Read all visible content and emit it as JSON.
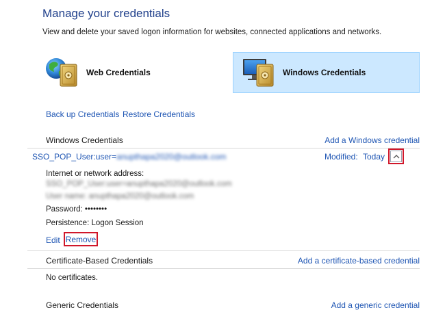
{
  "header": {
    "title": "Manage your credentials",
    "subtitle": "View and delete your saved logon information for websites, connected applications and networks."
  },
  "categories": {
    "web": {
      "label": "Web Credentials",
      "icon": "web-credentials-icon",
      "selected": false
    },
    "windows": {
      "label": "Windows Credentials",
      "icon": "windows-credentials-icon",
      "selected": true
    }
  },
  "actions": {
    "backup": "Back up Credentials",
    "restore": "Restore Credentials"
  },
  "windows_section": {
    "label": "Windows Credentials",
    "add_link": "Add a Windows credential",
    "entry": {
      "name_prefix": "SSO_POP_User:user=",
      "name_account": "anupthapa2020@outlook.com",
      "modified_label": "Modified:",
      "modified_value": "Today",
      "address_label": "Internet or network address:",
      "address_value": "SSO_POP_User:user=anupthapa2020@outlook.com",
      "username_value": "User name: anupthapa2020@outlook.com",
      "password_label": "Password:",
      "password_value": "••••••••",
      "persistence_label": "Persistence:",
      "persistence_value": "Logon Session",
      "edit_label": "Edit",
      "remove_label": "Remove",
      "collapse_glyph": "︿"
    }
  },
  "certificate_section": {
    "label": "Certificate-Based Credentials",
    "add_link": "Add a certificate-based credential",
    "empty_text": "No certificates."
  },
  "generic_section": {
    "label": "Generic Credentials",
    "add_link": "Add a generic credential"
  },
  "colors": {
    "title": "#1e3e8a",
    "link": "#1e55b3",
    "selected_bg": "#cce8ff",
    "highlight_box": "#d0172a"
  }
}
